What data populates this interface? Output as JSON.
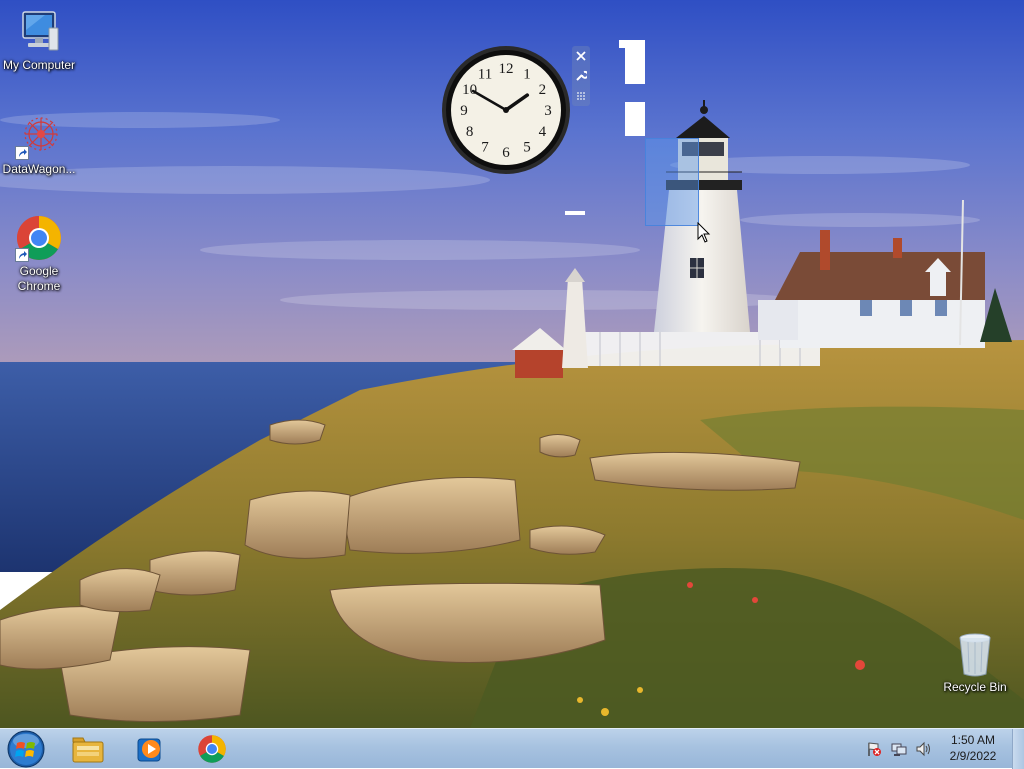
{
  "desktop": {
    "icons": [
      {
        "label": "My Computer",
        "icon": "computer-icon"
      },
      {
        "label": "DataWagon...",
        "icon": "datawagon-icon"
      },
      {
        "label": "Google Chrome",
        "icon": "chrome-icon"
      },
      {
        "label": "Recycle Bin",
        "icon": "recycle-bin-icon"
      }
    ]
  },
  "gadget": {
    "type": "clock",
    "numbers": [
      "12",
      "1",
      "2",
      "3",
      "4",
      "5",
      "6",
      "7",
      "8",
      "9",
      "10",
      "11"
    ],
    "hour_hand_time": "1:50",
    "controls": [
      "close-icon",
      "wrench-icon",
      "drag-handle-icon"
    ]
  },
  "taskbar": {
    "start": "start-orb-icon",
    "pinned": [
      "file-explorer-icon",
      "media-player-icon",
      "chrome-icon"
    ],
    "tray_icons": [
      "action-center-flag-icon",
      "network-icon",
      "volume-icon"
    ],
    "time": "1:50 AM",
    "date": "2/9/2022"
  },
  "colors": {
    "sky_top": "#3b57c8",
    "sky_mid": "#7f86c6",
    "sea": "#2c4fa0",
    "taskbar": "#a7c2e0"
  }
}
